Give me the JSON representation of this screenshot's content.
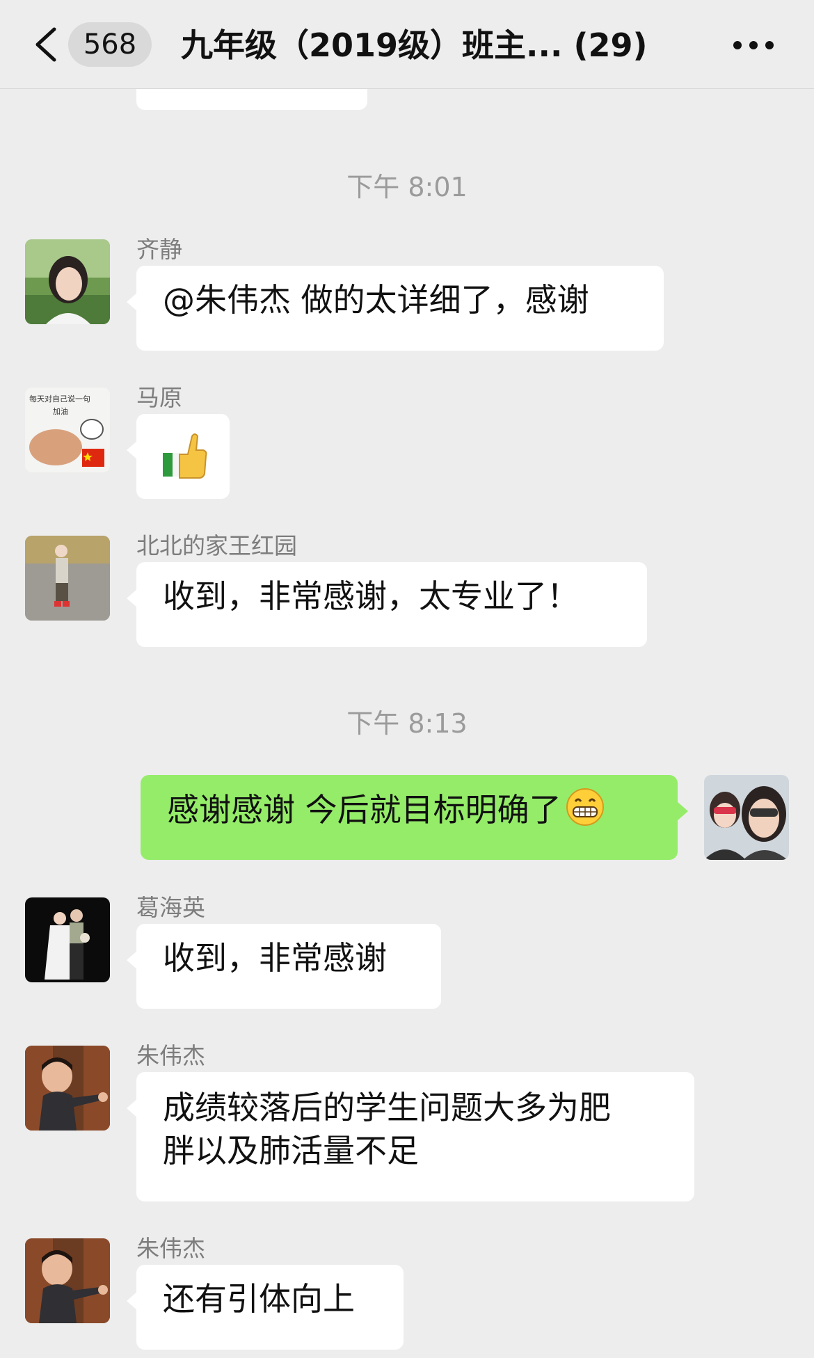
{
  "header": {
    "unread_count": "568",
    "title": "九年级（2019级）班主... (29)"
  },
  "timestamps": [
    "下午 8:01",
    "下午 8:13"
  ],
  "messages": [
    {
      "sender": "齐静",
      "text": "@朱伟杰 做的太详细了，感谢",
      "avatar": "photo-woman-avatar"
    },
    {
      "sender": "马原",
      "text": "",
      "sticker": "thumbs-up-icon",
      "avatar": "doodle-avatar"
    },
    {
      "sender": "北北的家王红园",
      "text": "收到，非常感谢，太专业了！",
      "avatar": "child-outdoor-avatar"
    },
    {
      "sender": "",
      "text": "感谢感谢 今后就目标明确了",
      "emoji": "grinning-face-icon",
      "avatar": "selfie-avatar",
      "self": true
    },
    {
      "sender": "葛海英",
      "text": "收到，非常感谢",
      "avatar": "wedding-photo-avatar"
    },
    {
      "sender": "朱伟杰",
      "text_line1": "成绩较落后的学生问题大多为肥",
      "text_line2": "胖以及肺活量不足",
      "avatar": "boy-pointing-avatar"
    },
    {
      "sender": "朱伟杰",
      "text": "还有引体向上",
      "avatar": "boy-pointing-avatar"
    }
  ],
  "colors": {
    "background": "#ededed",
    "self_bubble": "#95ec69",
    "other_bubble": "#ffffff",
    "timestamp": "#9b9b9b"
  }
}
